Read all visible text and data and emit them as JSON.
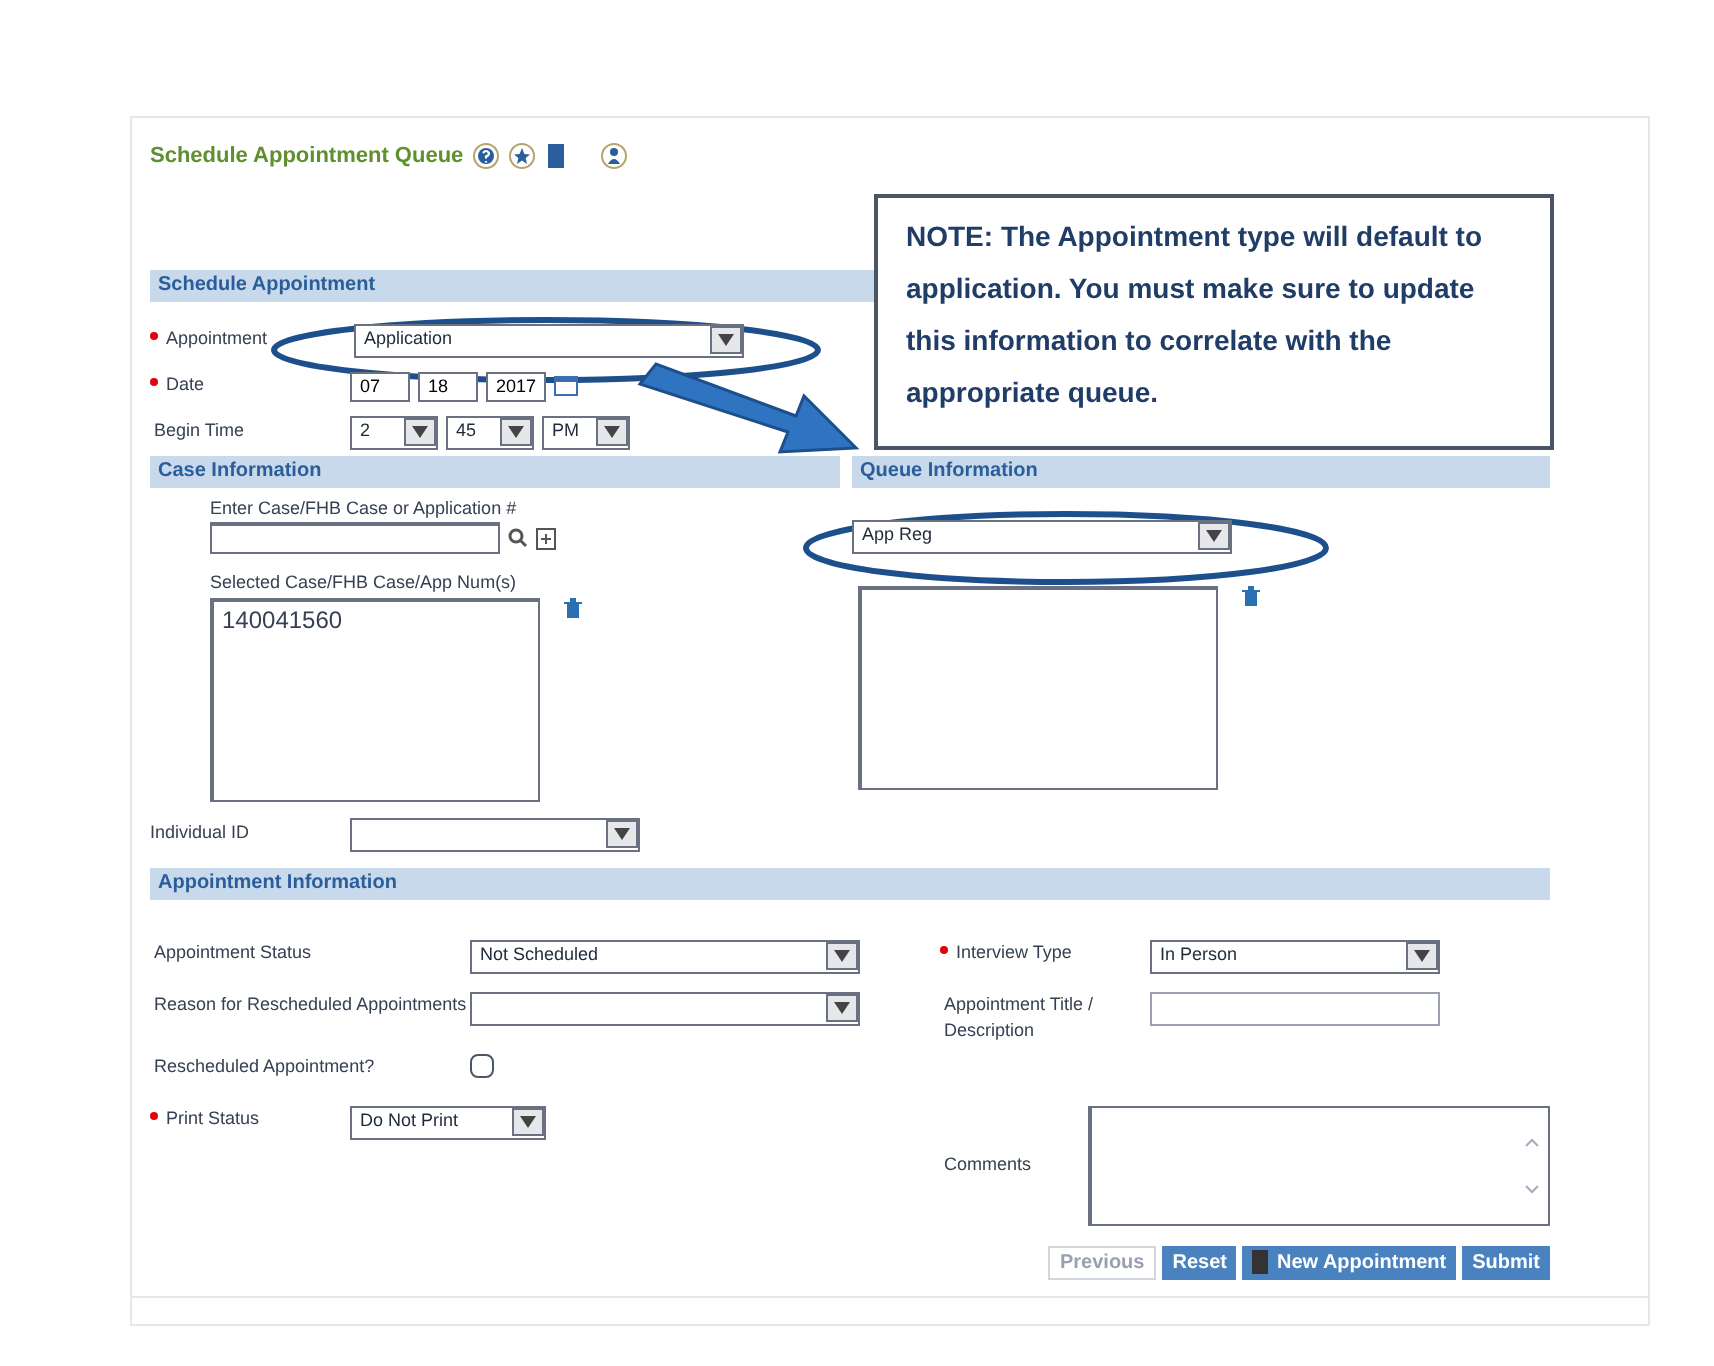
{
  "title": "Schedule Appointment Queue",
  "schedule_appointment": {
    "heading": "Schedule Appointment",
    "fields": [
      {
        "kind": "select",
        "label": "Appointment",
        "required": true,
        "value": "Application"
      },
      {
        "kind": "date",
        "label": "Date",
        "required": true,
        "parts": [
          "07",
          "18",
          "2017"
        ]
      },
      {
        "kind": "time",
        "label": "Begin Time",
        "required": false,
        "parts": [
          "2",
          "45",
          "PM"
        ]
      }
    ]
  },
  "case_information": {
    "heading": "Case Information",
    "search_label": "Enter Case/FHB Case or Application #",
    "selected_label": "Selected Case/FHB Case/App Num(s)",
    "selected_items": [
      "140041560"
    ],
    "individual_label": "Individual ID"
  },
  "queue_information": {
    "heading": "Queue Information",
    "queue": "App Reg"
  },
  "appointment_information": {
    "heading": "Appointment Information",
    "fields": [
      {
        "kind": "select",
        "label": "Appointment Status",
        "required": false,
        "value": "Not Scheduled"
      },
      {
        "kind": "select",
        "label": "Interview Type",
        "required": true,
        "value": "In Person"
      },
      {
        "kind": "select",
        "label": "Reason for Rescheduled Appointments",
        "required": false
      },
      {
        "kind": "text",
        "label": "Appointment Title / Description",
        "required": false
      },
      {
        "kind": "checkbox",
        "label": "Rescheduled Appointment?",
        "required": false,
        "checked": false
      },
      {
        "kind": "spacer"
      },
      {
        "kind": "small-select",
        "label": "Print Status",
        "required": true,
        "value": "Do Not Print"
      },
      {
        "kind": "textarea",
        "label": "Comments",
        "required": false
      }
    ]
  },
  "note": "NOTE: The Appointment type will default to application. You must make sure to update this information to correlate with the appropriate queue.",
  "buttons": [
    {
      "label": "Previous",
      "disabled": true,
      "icon": false
    },
    {
      "label": "Reset",
      "disabled": false,
      "icon": false
    },
    {
      "label": "New Appointment",
      "disabled": false,
      "icon": true
    },
    {
      "label": "Submit",
      "disabled": false,
      "icon": false
    }
  ]
}
